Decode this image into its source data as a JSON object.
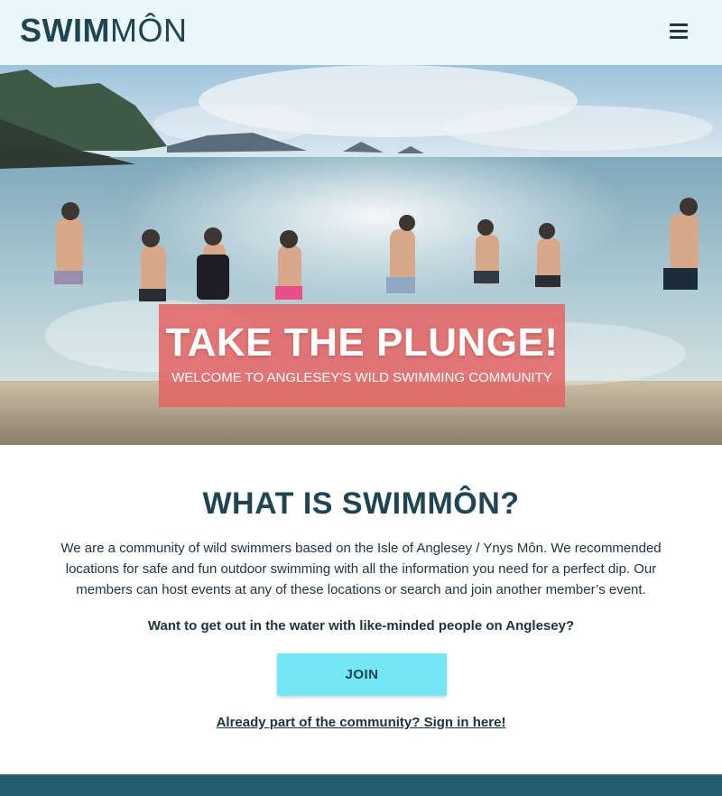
{
  "header": {
    "logo_bold": "SWIM",
    "logo_light": "MÔN",
    "menu_icon": "hamburger-menu-icon"
  },
  "hero": {
    "title": "TAKE THE PLUNGE!",
    "subtitle": "WELCOME TO ANGLESEY'S WILD SWIMMING COMMUNITY"
  },
  "about": {
    "title_prefix": "WHAT IS ",
    "title_bold": "SWIM",
    "title_light": "MÔN?",
    "description": "We are a community of wild swimmers based on the Isle of Anglesey / Ynys Môn. We recommended locations for safe and fun outdoor swimming with all the information you need for a perfect dip. Our members can host events at any of these locations or search and join another member’s event.",
    "question": "Want to get out in the water with like-minded people on Anglesey?",
    "join_label": "JOIN",
    "signin_label": "Already part of the community? Sign in here!"
  },
  "colors": {
    "header_bg": "#eaf8fc",
    "brand": "#1f4452",
    "hero_box": "#e46565",
    "join_button": "#74e6f6",
    "footer": "#245b70"
  }
}
